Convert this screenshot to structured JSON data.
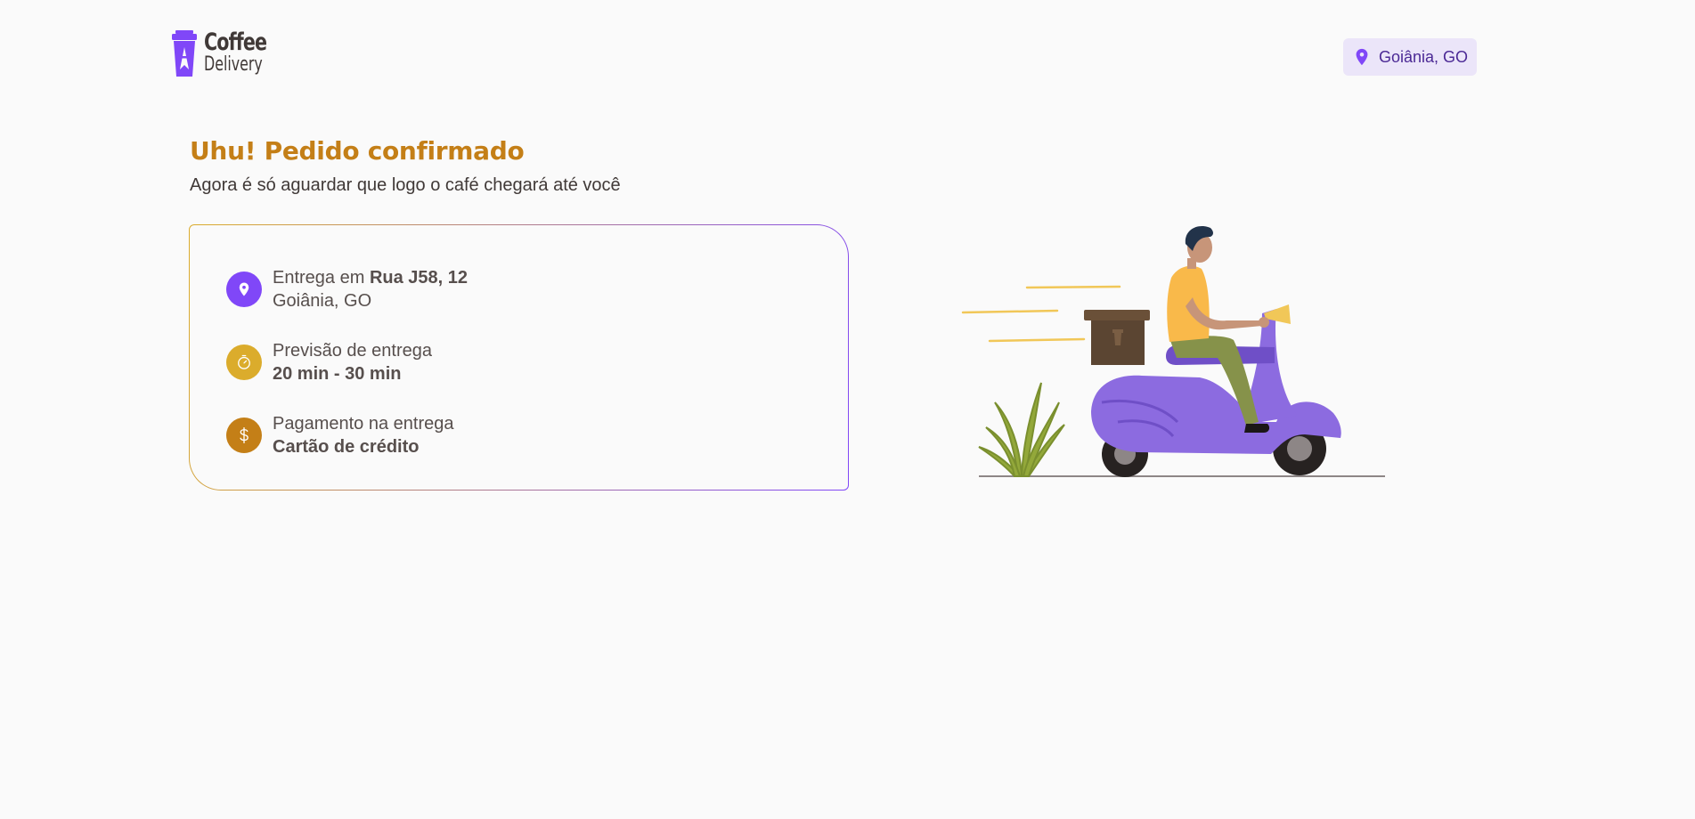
{
  "brand": {
    "title": "Coffee",
    "subtitle": "Delivery"
  },
  "header": {
    "location_label": "Goiânia, GO"
  },
  "page": {
    "title": "Uhu! Pedido confirmado",
    "subtitle": "Agora é só aguardar que logo o café chegará até você"
  },
  "order": {
    "delivery": {
      "prefix": "Entrega em ",
      "street": "Rua J58, 12",
      "city": "Goiânia, GO",
      "icon": "map-pin-icon",
      "color": "#8047F8"
    },
    "time": {
      "label": "Previsão de entrega",
      "value": "20 min - 30 min",
      "icon": "timer-icon",
      "color": "#DBAC2C"
    },
    "payment": {
      "label": "Pagamento na entrega",
      "value": "Cartão de crédito",
      "icon": "dollar-icon",
      "color": "#C47F17"
    }
  },
  "colors": {
    "purple": "#8047F8",
    "purple_dark": "#4B2995",
    "purple_light": "#EBE5F9",
    "yellow": "#DBAC2C",
    "yellow_dark": "#C47F17",
    "background": "#FAFAFA"
  }
}
